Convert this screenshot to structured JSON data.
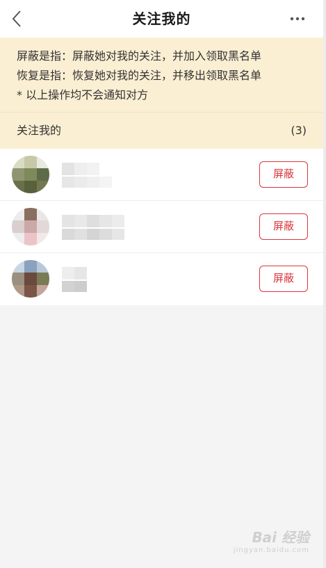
{
  "header": {
    "title": "关注我的"
  },
  "notice": {
    "lines": [
      "屏蔽是指：屏蔽她对我的关注，并加入领取黑名单",
      "恢复是指：恢复她对我的关注，并移出领取黑名单",
      "* 以上操作均不会通知对方"
    ]
  },
  "follower_section": {
    "label": "关注我的",
    "count": "(3)"
  },
  "followers": [
    {
      "action_label": "屏蔽"
    },
    {
      "action_label": "屏蔽"
    },
    {
      "action_label": "屏蔽"
    }
  ],
  "watermark": {
    "text": "Bai 经验",
    "sub": "jingyan.baidu.com"
  },
  "colors": {
    "accent": "#d9363e",
    "notice_bg": "#fbefd3",
    "page_bg": "#f4f4f4"
  }
}
